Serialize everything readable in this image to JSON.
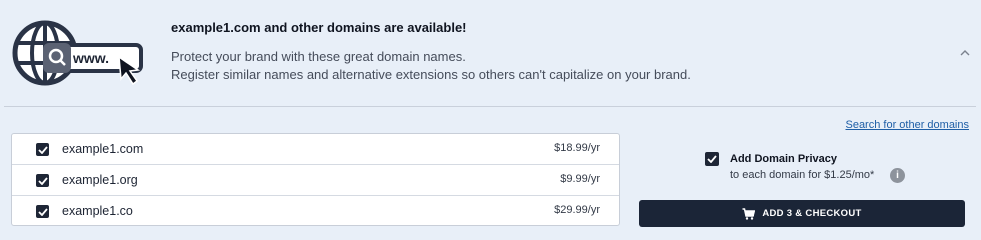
{
  "header": {
    "title": "example1.com and other domains are available!",
    "line1": "Protect your brand with these great domain names.",
    "line2": "Register similar names and alternative extensions so others can't capitalize on your brand.",
    "illustration_text": "www.",
    "collapse_icon": "chevron-up-icon"
  },
  "search_link": "Search for other domains",
  "domains": [
    {
      "name": "example1.com",
      "price": "$18.99/yr",
      "checked": true
    },
    {
      "name": "example1.org",
      "price": "$9.99/yr",
      "checked": true
    },
    {
      "name": "example1.co",
      "price": "$29.99/yr",
      "checked": true
    }
  ],
  "privacy": {
    "title": "Add Domain Privacy",
    "subtitle": "to each domain for  $1.25/mo*",
    "checked": true,
    "info_icon": "info-icon",
    "info_glyph": "i"
  },
  "checkout": {
    "label": "ADD 3 & CHECKOUT",
    "icon": "cart-icon"
  },
  "colors": {
    "background": "#e8eff8",
    "dark": "#1b2537",
    "link": "#1e5ea6"
  }
}
